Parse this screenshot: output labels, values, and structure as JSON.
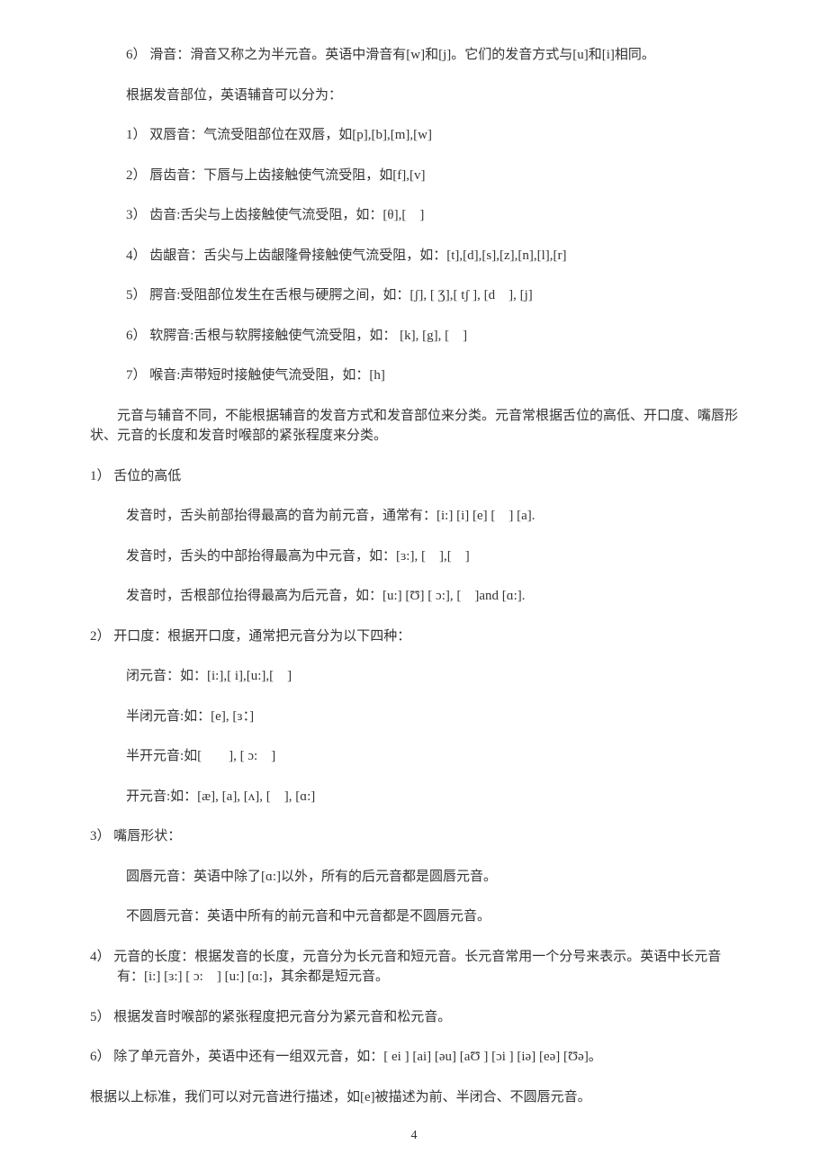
{
  "p_glide": "6） 滑音：滑音又称之为半元音。英语中滑音有[w]和[j]。它们的发音方式与[u]和[i]相同。",
  "p_place_intro": "根据发音部位，英语辅音可以分为：",
  "place1": "1） 双唇音：气流受阻部位在双唇，如[p],[b],[m],[w]",
  "place2": "2） 唇齿音：下唇与上齿接触使气流受阻，如[f],[v]",
  "place3": "3） 齿音:舌尖与上齿接触使气流受阻，如：[θ],[　]",
  "place4": "4） 齿龈音：舌尖与上齿龈隆骨接触使气流受阻，如：[t],[d],[s],[z],[n],[l],[r]",
  "place5": "5） 腭音:受阻部位发生在舌根与硬腭之间，如：[ʃ], [ Ʒ],[ tʃ ], [d　], [j]",
  "place6": "6） 软腭音:舌根与软腭接触使气流受阻，如： [k], [g], [　]",
  "place7": "7） 喉音:声带短时接触使气流受阻，如：[h]",
  "vowel_intro": "　　元音与辅音不同，不能根据辅音的发音方式和发音部位来分类。元音常根据舌位的高低、开口度、嘴唇形状、元音的长度和发音时喉部的紧张程度来分类。",
  "v1_head": "1） 舌位的高低",
  "v1_a": "发音时，舌头前部抬得最高的音为前元音，通常有：[i:] [i] [e] [　] [a].",
  "v1_b": "发音时，舌头的中部抬得最高为中元音，如：[ɜ:], [　],[　]",
  "v1_c": "发音时，舌根部位抬得最高为后元音，如：[u:] [Ʊ] [ ɔ:], [　]and [ɑ:].",
  "v2_head": "2） 开口度：根据开口度，通常把元音分为以下四种：",
  "v2_a": "闭元音：如：[i:],[ i],[u:],[　]",
  "v2_b": "半闭元音:如：[e], [ɜ：]",
  "v2_c": "半开元音:如[　　], [ ɔ:　]",
  "v2_d": "开元音:如：[æ], [a], [ʌ], [　], [ɑ:]",
  "v3_head": "3） 嘴唇形状：",
  "v3_a": "圆唇元音：英语中除了[ɑ:]以外，所有的后元音都是圆唇元音。",
  "v3_b": "不圆唇元音：英语中所有的前元音和中元音都是不圆唇元音。",
  "v4": "4） 元音的长度：根据发音的长度，元音分为长元音和短元音。长元音常用一个分号来表示。英语中长元音有：[i:] [ɜ:] [ ɔ:　] [u:] [ɑ:]，其余都是短元音。",
  "v5": "5） 根据发音时喉部的紧张程度把元音分为紧元音和松元音。",
  "v6": "6） 除了单元音外，英语中还有一组双元音，如：[ ei ] [ai] [əu] [aƱ ] [ɔi ] [iə] [eə] [Ʊə]。",
  "conclusion": "根据以上标准，我们可以对元音进行描述，如[e]被描述为前、半闭合、不圆唇元音。",
  "pagenum": "4"
}
